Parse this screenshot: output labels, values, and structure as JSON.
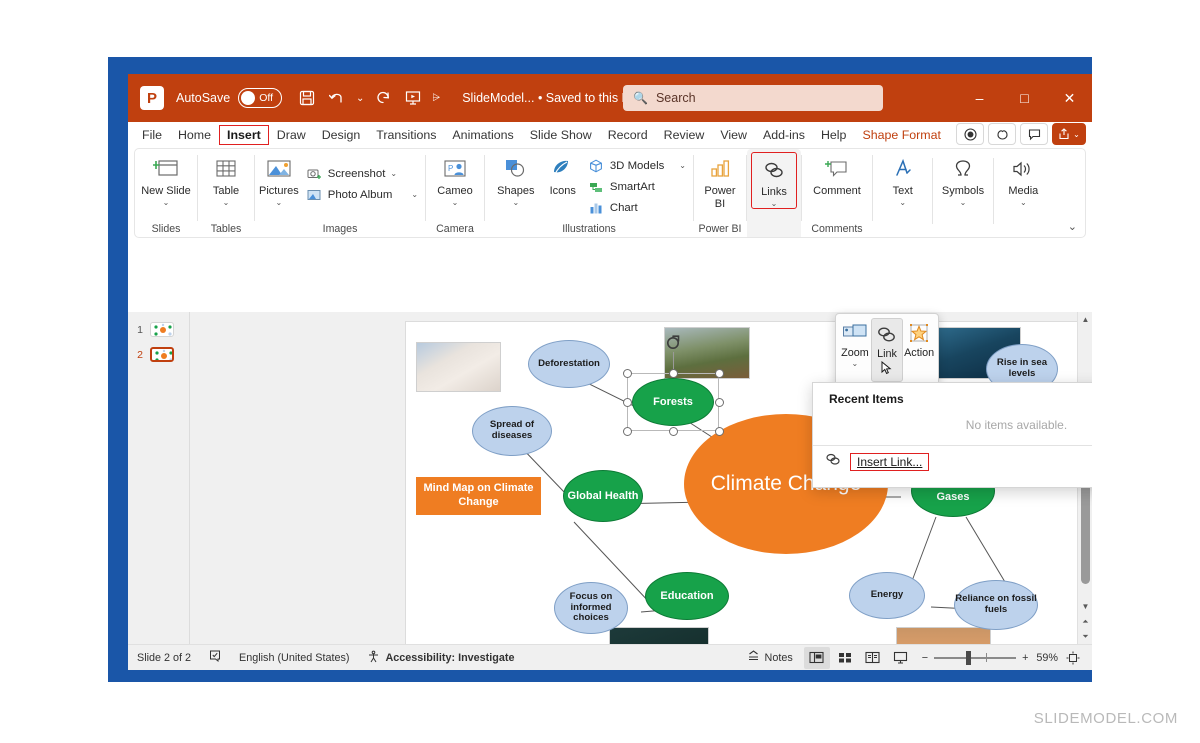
{
  "titlebar": {
    "logo": "powerpoint-logo",
    "autosave_label": "AutoSave",
    "autosave_state": "Off",
    "save_icon": "save-icon",
    "undo_icon": "undo-icon",
    "redo_icon": "redo-icon",
    "present_icon": "start-presentation-icon",
    "more_icon": "quick-access-more-icon",
    "document_title": "SlideModel... • Saved to this PC",
    "search_placeholder": "Search",
    "minimize": "–",
    "maximize": "□",
    "close": "✕"
  },
  "tabs": [
    {
      "label": "File",
      "state": "normal"
    },
    {
      "label": "Home",
      "state": "normal"
    },
    {
      "label": "Insert",
      "state": "highlighted"
    },
    {
      "label": "Draw",
      "state": "normal"
    },
    {
      "label": "Design",
      "state": "normal"
    },
    {
      "label": "Transitions",
      "state": "normal"
    },
    {
      "label": "Animations",
      "state": "normal"
    },
    {
      "label": "Slide Show",
      "state": "normal"
    },
    {
      "label": "Record",
      "state": "normal"
    },
    {
      "label": "Review",
      "state": "normal"
    },
    {
      "label": "View",
      "state": "normal"
    },
    {
      "label": "Add-ins",
      "state": "normal"
    },
    {
      "label": "Help",
      "state": "normal"
    },
    {
      "label": "Shape Format",
      "state": "contextual"
    }
  ],
  "tabs_right": {
    "record_button": "record-icon",
    "copilot_button": "copilot-icon",
    "comments_button": "comments-icon",
    "share_button": "share-icon",
    "share_caret": "⌄"
  },
  "ribbon": {
    "groups": [
      {
        "label": "Slides",
        "buttons": [
          {
            "label": "New Slide",
            "icon": "new-slide-icon",
            "caret": "⌄"
          }
        ]
      },
      {
        "label": "Tables",
        "buttons": [
          {
            "label": "Table",
            "icon": "table-icon",
            "caret": "⌄"
          }
        ]
      },
      {
        "label": "Images",
        "buttons": [
          {
            "label": "Pictures",
            "icon": "pictures-icon",
            "caret": "⌄"
          }
        ],
        "small_buttons": [
          {
            "label": "Screenshot",
            "icon": "screenshot-icon",
            "caret": "⌄"
          },
          {
            "label": "Photo Album",
            "icon": "photo-album-icon",
            "caret": "⌄"
          }
        ]
      },
      {
        "label": "Camera",
        "buttons": [
          {
            "label": "Cameo",
            "icon": "cameo-icon",
            "caret": "⌄"
          }
        ]
      },
      {
        "label": "Illustrations",
        "buttons": [
          {
            "label": "Shapes",
            "icon": "shapes-icon",
            "caret": "⌄"
          },
          {
            "label": "Icons",
            "icon": "icons-icon",
            "caret": ""
          }
        ],
        "small_buttons": [
          {
            "label": "3D Models",
            "icon": "3d-models-icon",
            "caret": "⌄"
          },
          {
            "label": "SmartArt",
            "icon": "smartart-icon",
            "caret": ""
          },
          {
            "label": "Chart",
            "icon": "chart-icon",
            "caret": ""
          }
        ]
      },
      {
        "label": "Power BI",
        "buttons": [
          {
            "label": "Power BI",
            "icon": "power-bi-icon",
            "caret": ""
          }
        ]
      },
      {
        "label": "",
        "buttons": [
          {
            "label": "Links",
            "icon": "links-icon",
            "caret": "⌄"
          }
        ]
      },
      {
        "label": "Comments",
        "buttons": [
          {
            "label": "Comment",
            "icon": "comment-icon",
            "caret": ""
          }
        ]
      },
      {
        "label": "",
        "buttons": [
          {
            "label": "Text",
            "icon": "text-icon",
            "caret": "⌄"
          },
          {
            "label": "Symbols",
            "icon": "symbols-icon",
            "caret": "⌄"
          },
          {
            "label": "Media",
            "icon": "media-icon",
            "caret": "⌄"
          }
        ]
      }
    ],
    "collapse_caret": "⌄"
  },
  "links_dropdown": {
    "items": [
      {
        "label": "Zoom",
        "icon": "zoom-icon",
        "caret": "⌄",
        "state": "normal"
      },
      {
        "label": "Link",
        "icon": "link-icon",
        "caret": "",
        "state": "hover"
      },
      {
        "label": "Action",
        "icon": "action-icon",
        "caret": "",
        "state": "normal"
      }
    ]
  },
  "recent_panel": {
    "title": "Recent Items",
    "empty_message": "No items available.",
    "insert_link_icon": "link-icon",
    "insert_link_label": "Insert Link...",
    "grip": "• • • •"
  },
  "thumbnails": [
    {
      "number": "1",
      "selected": false
    },
    {
      "number": "2",
      "selected": true
    }
  ],
  "statusbar": {
    "slide_counter": "Slide 2 of 2",
    "spellcheck_icon": "spellcheck-icon",
    "language": "English (United States)",
    "accessibility_icon": "accessibility-icon",
    "accessibility": "Accessibility: Investigate",
    "notes_icon": "notes-icon",
    "notes_label": "Notes",
    "views": [
      {
        "name": "normal-view",
        "icon": "normal-view-icon",
        "active": true
      },
      {
        "name": "slide-sorter-view",
        "icon": "slide-sorter-icon",
        "active": false
      },
      {
        "name": "reading-view",
        "icon": "reading-view-icon",
        "active": false
      },
      {
        "name": "slide-show-view",
        "icon": "slide-show-icon",
        "active": false
      }
    ],
    "zoom_out": "−",
    "zoom_in": "+",
    "zoom_level": "59%",
    "fit_icon": "fit-to-window-icon"
  },
  "slide": {
    "legend": "Mind Map on Climate Change",
    "center_node": "Climate Change",
    "green_nodes": [
      {
        "label": "Forests",
        "selected": true
      },
      {
        "label": "Global Health",
        "selected": false
      },
      {
        "label": "Education",
        "selected": false
      },
      {
        "label": "Greenhouse Gases",
        "selected": false
      }
    ],
    "blue_nodes": [
      {
        "label": "Deforestation"
      },
      {
        "label": "Spread of diseases"
      },
      {
        "label": "Focus on informed choices"
      },
      {
        "label": "Rise in sea levels"
      },
      {
        "label": "Energy"
      },
      {
        "label": "Reliance on fossil fuels"
      }
    ],
    "images": [
      {
        "name": "hand-mouse-photo"
      },
      {
        "name": "forest-hillside-photo"
      },
      {
        "name": "underwater-ice-photo"
      },
      {
        "name": "classroom-blackboard-photo"
      },
      {
        "name": "factory-smokestack-photo"
      }
    ]
  },
  "watermark": "SLIDEMODEL.COM",
  "colors": {
    "brand_orange": "#c0400f",
    "accent_orange": "#ef7d22",
    "node_green": "#17a24a",
    "node_blue": "#bdd2ec",
    "highlight_red": "#e02020",
    "frame_blue": "#1a56a8"
  }
}
